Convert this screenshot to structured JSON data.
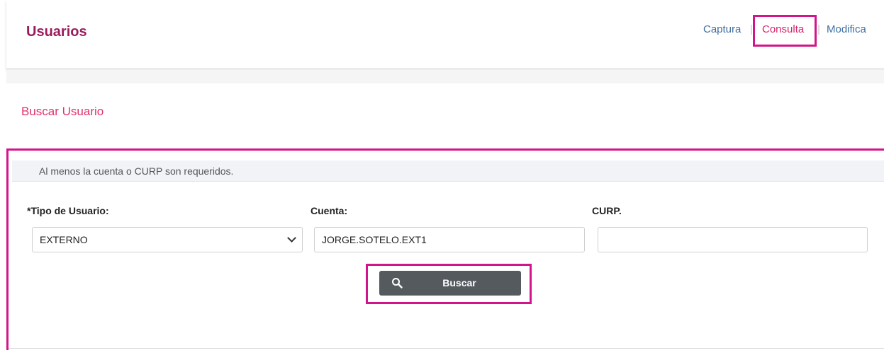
{
  "header": {
    "title": "Usuarios",
    "nav": [
      {
        "label": "Captura",
        "active": false
      },
      {
        "label": "Consulta",
        "active": true
      },
      {
        "label": "Modifica",
        "active": false
      }
    ],
    "separator": "|"
  },
  "panel": {
    "title": "Buscar Usuario",
    "info": "Al menos la cuenta o CURP son requeridos."
  },
  "form": {
    "tipo_label": "*Tipo de Usuario:",
    "tipo_value": "EXTERNO",
    "cuenta_label": "Cuenta:",
    "cuenta_value": "JORGE.SOTELO.EXT1",
    "curp_label": "CURP.",
    "curp_value": ""
  },
  "actions": {
    "buscar_label": "Buscar",
    "buscar_icon": "search-icon"
  },
  "colors": {
    "title": "#9b1c5c",
    "accent": "#e1306c",
    "highlight": "#d4148c",
    "button": "#555a5f",
    "link": "#3f6fa0"
  }
}
